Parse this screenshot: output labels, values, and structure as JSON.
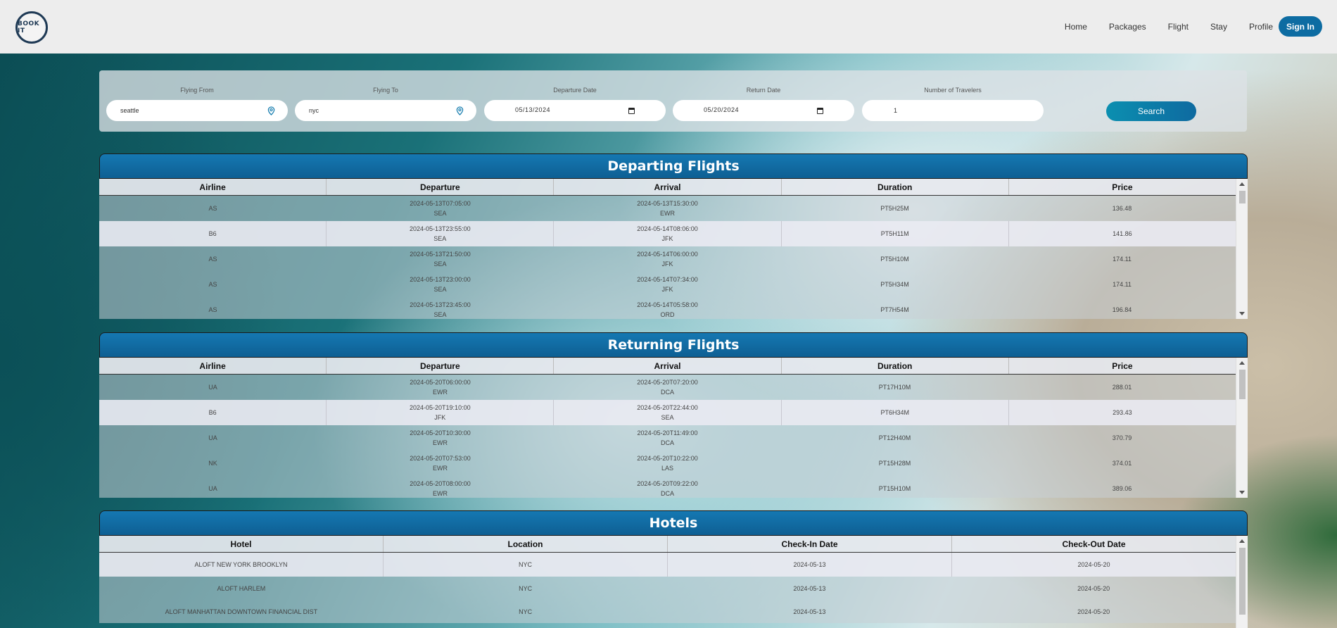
{
  "header": {
    "logo_text": "BOOK IT",
    "nav": [
      "Home",
      "Packages",
      "Flight",
      "Stay",
      "Profile"
    ],
    "signin_label": "Sign In"
  },
  "search": {
    "fields": [
      {
        "label": "Flying From",
        "value": "seattle",
        "icon": "location-pin-icon"
      },
      {
        "label": "Flying To",
        "value": "nyc",
        "icon": "location-pin-icon"
      },
      {
        "label": "Departure Date",
        "value": "05/13/2024",
        "icon": "calendar-icon"
      },
      {
        "label": "Return Date",
        "value": "05/20/2024",
        "icon": "calendar-icon"
      },
      {
        "label": "Number of Travelers",
        "value": "1"
      }
    ],
    "button_label": "Search",
    "accent": "#0e6aa0"
  },
  "departing": {
    "title": "Departing Flights",
    "columns": [
      "Airline",
      "Departure",
      "Arrival",
      "Duration",
      "Price"
    ],
    "rows": [
      {
        "airline": "AS",
        "dep_time": "2024-05-13T07:05:00",
        "dep_code": "SEA",
        "arr_time": "2024-05-13T15:30:00",
        "arr_code": "EWR",
        "duration": "PT5H25M",
        "price": "136.48"
      },
      {
        "airline": "B6",
        "dep_time": "2024-05-13T23:55:00",
        "dep_code": "SEA",
        "arr_time": "2024-05-14T08:06:00",
        "arr_code": "JFK",
        "duration": "PT5H11M",
        "price": "141.86"
      },
      {
        "airline": "AS",
        "dep_time": "2024-05-13T21:50:00",
        "dep_code": "SEA",
        "arr_time": "2024-05-14T06:00:00",
        "arr_code": "JFK",
        "duration": "PT5H10M",
        "price": "174.11"
      },
      {
        "airline": "AS",
        "dep_time": "2024-05-13T23:00:00",
        "dep_code": "SEA",
        "arr_time": "2024-05-14T07:34:00",
        "arr_code": "JFK",
        "duration": "PT5H34M",
        "price": "174.11"
      },
      {
        "airline": "AS",
        "dep_time": "2024-05-13T23:45:00",
        "dep_code": "SEA",
        "arr_time": "2024-05-14T05:58:00",
        "arr_code": "ORD",
        "duration": "PT7H54M",
        "price": "196.84"
      }
    ]
  },
  "returning": {
    "title": "Returning Flights",
    "columns": [
      "Airline",
      "Departure",
      "Arrival",
      "Duration",
      "Price"
    ],
    "rows": [
      {
        "airline": "UA",
        "dep_time": "2024-05-20T06:00:00",
        "dep_code": "EWR",
        "arr_time": "2024-05-20T07:20:00",
        "arr_code": "DCA",
        "duration": "PT17H10M",
        "price": "288.01"
      },
      {
        "airline": "B6",
        "dep_time": "2024-05-20T19:10:00",
        "dep_code": "JFK",
        "arr_time": "2024-05-20T22:44:00",
        "arr_code": "SEA",
        "duration": "PT6H34M",
        "price": "293.43"
      },
      {
        "airline": "UA",
        "dep_time": "2024-05-20T10:30:00",
        "dep_code": "EWR",
        "arr_time": "2024-05-20T11:49:00",
        "arr_code": "DCA",
        "duration": "PT12H40M",
        "price": "370.79"
      },
      {
        "airline": "NK",
        "dep_time": "2024-05-20T07:53:00",
        "dep_code": "EWR",
        "arr_time": "2024-05-20T10:22:00",
        "arr_code": "LAS",
        "duration": "PT15H28M",
        "price": "374.01"
      },
      {
        "airline": "UA",
        "dep_time": "2024-05-20T08:00:00",
        "dep_code": "EWR",
        "arr_time": "2024-05-20T09:22:00",
        "arr_code": "DCA",
        "duration": "PT15H10M",
        "price": "389.06"
      }
    ]
  },
  "hotels": {
    "title": "Hotels",
    "columns": [
      "Hotel",
      "Location",
      "Check-In Date",
      "Check-Out Date"
    ],
    "rows": [
      {
        "hotel": "ALOFT NEW YORK BROOKLYN",
        "location": "NYC",
        "checkin": "2024-05-13",
        "checkout": "2024-05-20"
      },
      {
        "hotel": "ALOFT HARLEM",
        "location": "NYC",
        "checkin": "2024-05-13",
        "checkout": "2024-05-20"
      },
      {
        "hotel": "ALOFT MANHATTAN DOWNTOWN FINANCIAL DIST",
        "location": "NYC",
        "checkin": "2024-05-13",
        "checkout": "2024-05-20"
      }
    ]
  }
}
